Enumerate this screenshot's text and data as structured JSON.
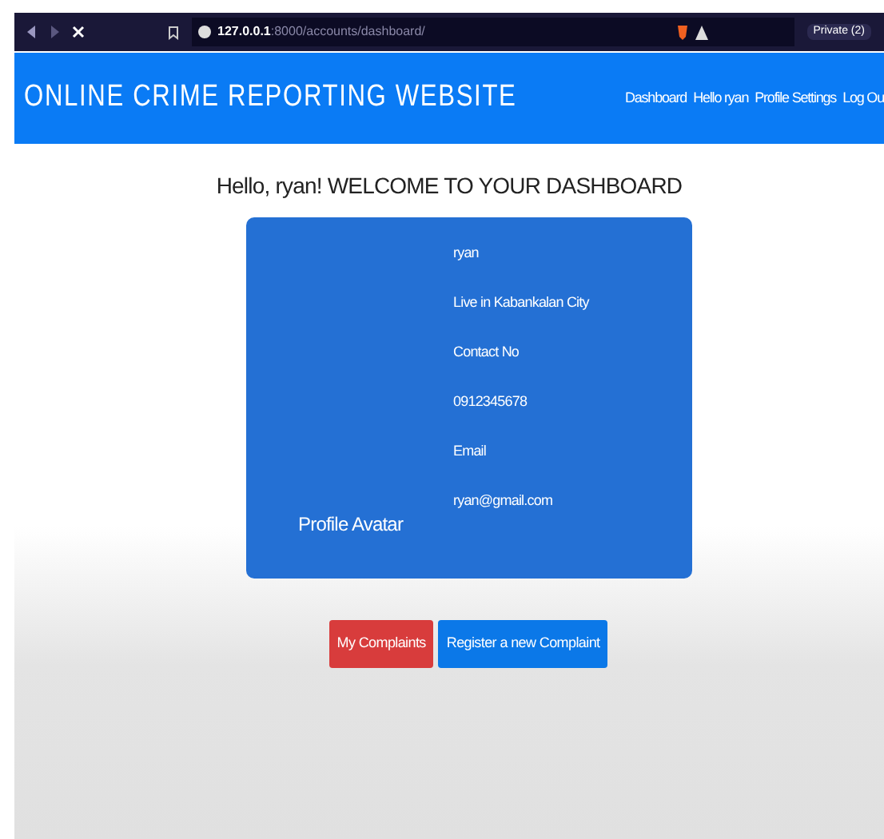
{
  "browser": {
    "url_host": "127.0.0.1",
    "url_path": ":8000/accounts/dashboard/",
    "private_label": "Private (2)"
  },
  "header": {
    "title": "ONLINE CRIME REPORTING WEBSITE",
    "nav": [
      "Dashboard",
      "Hello ryan",
      "Profile Settings",
      "Log Ou"
    ]
  },
  "heading": "Hello, ryan! WELCOME TO YOUR DASHBOARD",
  "profile": {
    "avatar_label": "Profile Avatar",
    "lines": [
      "ryan",
      "Live in Kabankalan City",
      "Contact No",
      "0912345678",
      "Email",
      "ryan@gmail.com"
    ]
  },
  "buttons": [
    {
      "label": "My Complaints",
      "kind": "danger"
    },
    {
      "label": "Register a new Complaint",
      "kind": "primary"
    }
  ]
}
